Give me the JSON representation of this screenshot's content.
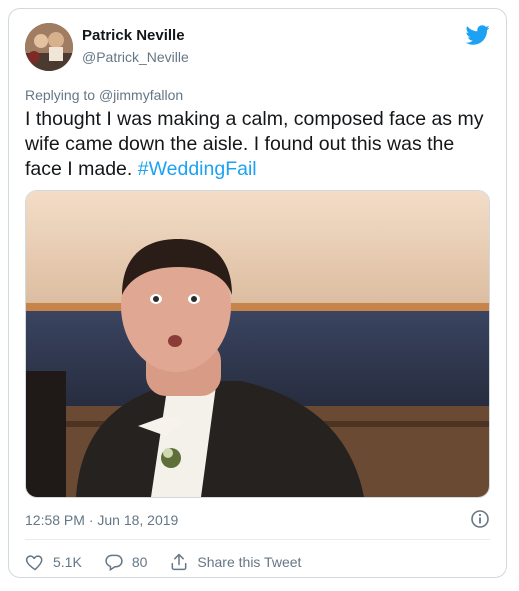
{
  "user": {
    "name": "Patrick Neville",
    "handle": "@Patrick_Neville"
  },
  "reply": {
    "prefix": "Replying to ",
    "to": "@jimmyfallon"
  },
  "tweet": {
    "text": "I thought I was making a calm, composed face as my wife came down the aisle. I found out this was the face I made. ",
    "hashtag": "#WeddingFail"
  },
  "meta": {
    "timestamp": "12:58 PM · Jun 18, 2019"
  },
  "actions": {
    "likes": "5.1K",
    "replies": "80",
    "share_label": "Share this Tweet"
  },
  "icons": {
    "brand": "twitter-bird-icon",
    "info": "info-icon",
    "like": "heart-icon",
    "reply": "reply-icon",
    "share": "share-icon"
  },
  "colors": {
    "brand": "#1da1f2",
    "text": "#14171a",
    "muted": "#657786",
    "border": "#cfd9de"
  }
}
